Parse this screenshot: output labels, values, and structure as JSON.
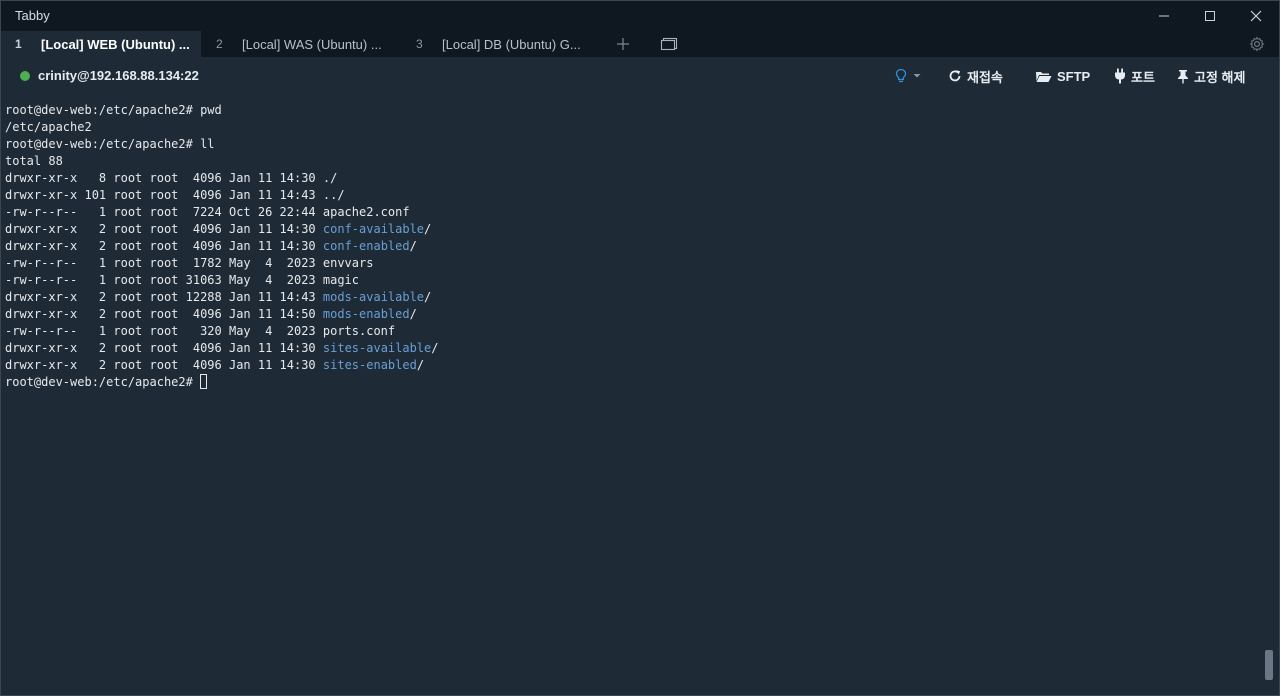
{
  "window": {
    "title": "Tabby"
  },
  "tabs": [
    {
      "num": "1",
      "title": "[Local] WEB (Ubuntu) ...",
      "active": true
    },
    {
      "num": "2",
      "title": "[Local] WAS (Ubuntu) ...",
      "active": false
    },
    {
      "num": "3",
      "title": "[Local] DB (Ubuntu) G...",
      "active": false
    }
  ],
  "toolbar": {
    "host": "crinity@192.168.88.134:22",
    "reconnect_label": "재접속",
    "sftp_label": "SFTP",
    "ports_label": "포트",
    "pin_label": "고정 해제"
  },
  "colors": {
    "background": "#1e2a36",
    "titlebar": "#0f1821",
    "connected": "#4caf50",
    "directory": "#6a9fd4",
    "bulb": "#2f8fd8"
  },
  "icons": [
    "minimize-icon",
    "maximize-icon",
    "close-icon",
    "plus-icon",
    "dock-icon",
    "gear-icon",
    "lightbulb-icon",
    "reload-icon",
    "folder-open-icon",
    "plug-icon",
    "pin-icon"
  ],
  "terminal": {
    "lines": [
      {
        "text": "root@dev-web:/etc/apache2# pwd"
      },
      {
        "text": "/etc/apache2"
      },
      {
        "text": "root@dev-web:/etc/apache2# ll"
      },
      {
        "text": "total 88"
      },
      {
        "text": "drwxr-xr-x   8 root root  4096 Jan 11 14:30 ./"
      },
      {
        "text": "drwxr-xr-x 101 root root  4096 Jan 11 14:43 ../"
      },
      {
        "text": "-rw-r--r--   1 root root  7224 Oct 26 22:44 apache2.conf"
      },
      {
        "prefix": "drwxr-xr-x   2 root root  4096 Jan 11 14:30 ",
        "dir": "conf-available",
        "suffix": "/"
      },
      {
        "prefix": "drwxr-xr-x   2 root root  4096 Jan 11 14:30 ",
        "dir": "conf-enabled",
        "suffix": "/"
      },
      {
        "text": "-rw-r--r--   1 root root  1782 May  4  2023 envvars"
      },
      {
        "text": "-rw-r--r--   1 root root 31063 May  4  2023 magic"
      },
      {
        "prefix": "drwxr-xr-x   2 root root 12288 Jan 11 14:43 ",
        "dir": "mods-available",
        "suffix": "/"
      },
      {
        "prefix": "drwxr-xr-x   2 root root  4096 Jan 11 14:50 ",
        "dir": "mods-enabled",
        "suffix": "/"
      },
      {
        "text": "-rw-r--r--   1 root root   320 May  4  2023 ports.conf"
      },
      {
        "prefix": "drwxr-xr-x   2 root root  4096 Jan 11 14:30 ",
        "dir": "sites-available",
        "suffix": "/"
      },
      {
        "prefix": "drwxr-xr-x   2 root root  4096 Jan 11 14:30 ",
        "dir": "sites-enabled",
        "suffix": "/"
      },
      {
        "prompt": "root@dev-web:/etc/apache2# "
      }
    ]
  }
}
